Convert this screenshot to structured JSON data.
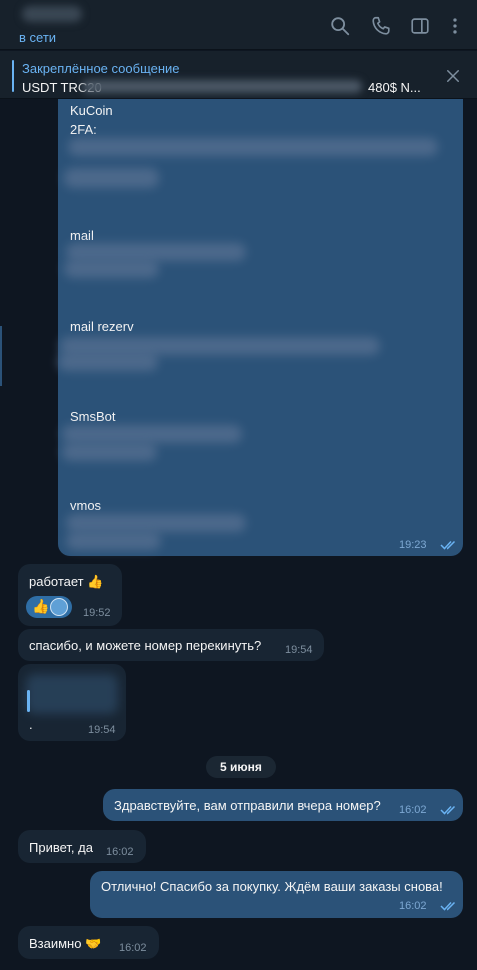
{
  "header": {
    "status": "в сети"
  },
  "pinned": {
    "title": "Закреплённое сообщение",
    "text_start": "USDT TRC20",
    "text_end": "480$ N..."
  },
  "messages": {
    "big": {
      "kucoin": "KuCoin",
      "twofa": "2FA:",
      "mail": "mail",
      "mail_rezerv": "mail rezerv",
      "smsbot": "SmsBot",
      "vmos": "vmos",
      "time": "19:23"
    },
    "m1": {
      "text": "работает 👍",
      "time": "19:52",
      "reaction": "👍"
    },
    "m2": {
      "text": "спасибо, и можете номер перекинуть?",
      "time": "19:54"
    },
    "m3": {
      "text": ".",
      "time": "19:54"
    },
    "date": "5 июня",
    "m4": {
      "text": "Здравствуйте, вам отправили вчера номер?",
      "time": "16:02"
    },
    "m5": {
      "text": "Привет, да",
      "time": "16:02"
    },
    "m6": {
      "text": "Отлично! Спасибо за покупку. Ждём ваши заказы снова!",
      "time": "16:02"
    },
    "m7": {
      "text": "Взаимно 🤝",
      "time": "16:02"
    }
  },
  "icons": [
    "search-icon",
    "phone-icon",
    "sidebar-toggle-icon",
    "more-vert-icon",
    "close-icon",
    "double-check-icon"
  ],
  "colors": {
    "accent": "#6ab3f3",
    "outgoing": "#2b5278",
    "incoming": "#182533",
    "background": "#0e1621"
  }
}
